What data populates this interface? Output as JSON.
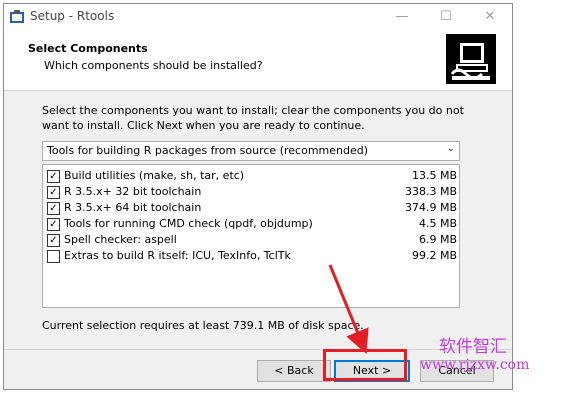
{
  "window": {
    "title": "Setup - Rtools",
    "minimize_glyph": "—",
    "maximize_glyph": "☐",
    "close_glyph": "✕"
  },
  "header": {
    "title": "Select Components",
    "subtitle": "Which components should be installed?"
  },
  "body": {
    "description": "Select the components you want to install; clear the components you do not want to install. Click Next when you are ready to continue.",
    "install_type": "Tools for building R packages from source (recommended)",
    "components": [
      {
        "label": "Build utilities (make, sh, tar, etc)",
        "size": "13.5 MB",
        "checked": true
      },
      {
        "label": "R 3.5.x+ 32 bit toolchain",
        "size": "338.3 MB",
        "checked": true
      },
      {
        "label": "R 3.5.x+ 64 bit toolchain",
        "size": "374.9 MB",
        "checked": true
      },
      {
        "label": "Tools for running CMD check (qpdf, objdump)",
        "size": "4.5 MB",
        "checked": true
      },
      {
        "label": "Spell checker: aspell",
        "size": "6.9 MB",
        "checked": true
      },
      {
        "label": "Extras to build R itself: ICU, TexInfo, TclTk",
        "size": "99.2 MB",
        "checked": false
      }
    ],
    "space_required": "Current selection requires at least 739.1 MB of disk space."
  },
  "footer": {
    "back_label": "< Back",
    "next_label": "Next >",
    "cancel_label": "Cancel"
  },
  "watermark": {
    "line1": "软件智汇",
    "line2": "www.rjzxw.com"
  },
  "colors": {
    "accent_border": "#0078d7",
    "annotation_red": "#e21f27",
    "watermark": "#c23bd8"
  }
}
